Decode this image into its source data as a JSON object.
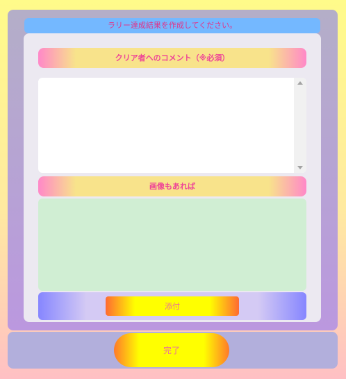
{
  "header": {
    "title": "ラリー達成結果を作成してください。"
  },
  "comment_section": {
    "label": "クリア者へのコメント（※必須）",
    "value": "",
    "placeholder": ""
  },
  "image_section": {
    "label": "画像もあれば"
  },
  "attach": {
    "label": "添付"
  },
  "footer": {
    "done_label": "完了"
  },
  "colors": {
    "header_bar": "#74b8ff",
    "section_text": "#ee4497",
    "image_area": "#d0eed3",
    "button_yellow": "#ffff00",
    "button_orange": "#ff6a32"
  }
}
